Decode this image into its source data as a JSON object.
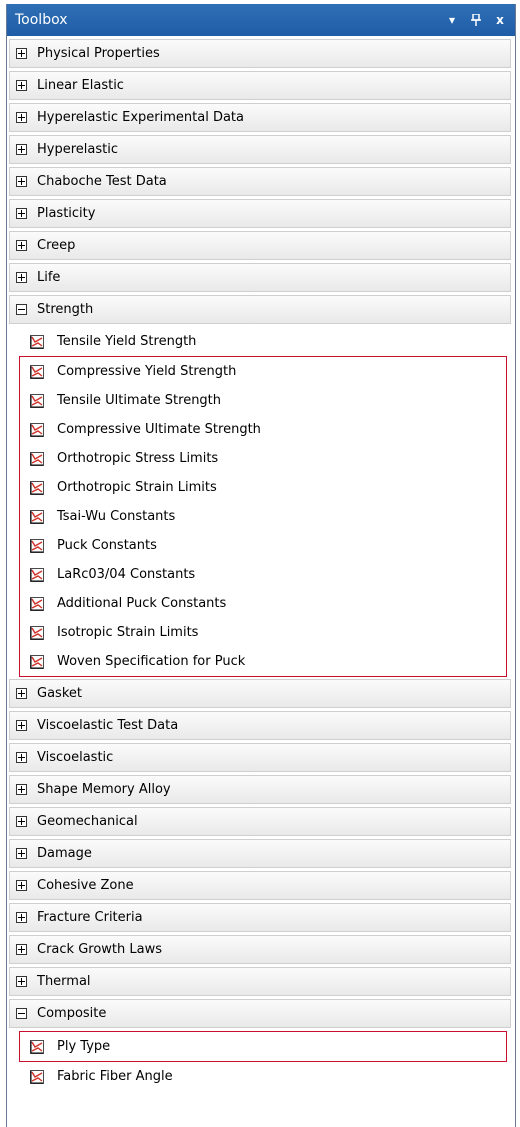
{
  "toolbox": {
    "title": "Toolbox",
    "controls": {
      "dropdown_icon": "dropdown-arrow-icon",
      "pin_icon": "pin-icon",
      "close_icon": "close-icon",
      "dropdown": "▾",
      "pin": "ᴘ",
      "close": "x"
    },
    "categories": {
      "physical_properties": "Physical Properties",
      "linear_elastic": "Linear Elastic",
      "hyperelastic_experimental_data": "Hyperelastic Experimental Data",
      "hyperelastic": "Hyperelastic",
      "chaboche_test_data": "Chaboche Test Data",
      "plasticity": "Plasticity",
      "creep": "Creep",
      "life": "Life",
      "strength": "Strength",
      "gasket": "Gasket",
      "viscoelastic_test_data": "Viscoelastic Test Data",
      "viscoelastic": "Viscoelastic",
      "shape_memory_alloy": "Shape Memory Alloy",
      "geomechanical": "Geomechanical",
      "damage": "Damage",
      "cohesive_zone": "Cohesive Zone",
      "fracture_criteria": "Fracture Criteria",
      "crack_growth_laws": "Crack Growth Laws",
      "thermal": "Thermal",
      "composite": "Composite"
    },
    "strength_items": [
      "Tensile Yield Strength",
      "Compressive Yield Strength",
      "Tensile Ultimate Strength",
      "Compressive Ultimate Strength",
      "Orthotropic Stress Limits",
      "Orthotropic Strain Limits",
      "Tsai-Wu Constants",
      "Puck Constants",
      "LaRc03/04 Constants",
      "Additional Puck Constants",
      "Isotropic Strain Limits",
      "Woven Specification for Puck"
    ],
    "composite_items": [
      "Ply Type",
      "Fabric Fiber Angle"
    ]
  },
  "colors": {
    "title_bar": "#2f6fb5",
    "highlight_border": "#c8102e"
  }
}
